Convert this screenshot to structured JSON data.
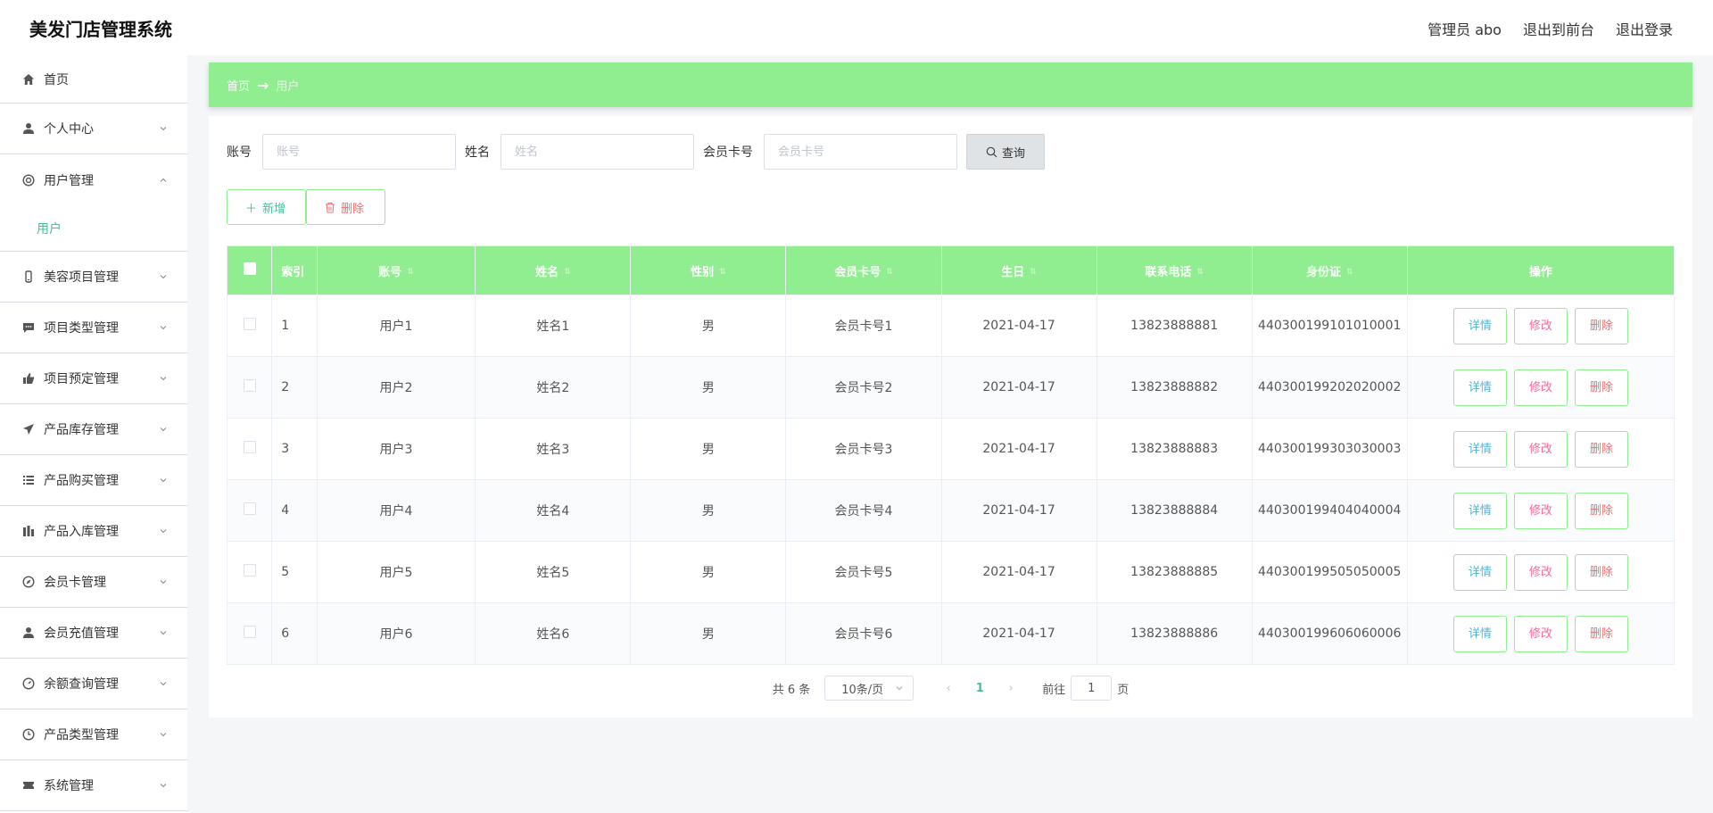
{
  "header": {
    "title": "美发门店管理系统",
    "admin_label": "管理员 abo",
    "back_front_label": "退出到前台",
    "logout_label": "退出登录"
  },
  "sidebar": {
    "items": [
      {
        "label": "首页",
        "icon": "home-icon"
      },
      {
        "label": "个人中心",
        "icon": "user-icon"
      },
      {
        "label": "用户管理",
        "icon": "lifebuoy-icon",
        "open": true,
        "children": [
          {
            "label": "用户"
          }
        ]
      },
      {
        "label": "美容项目管理",
        "icon": "mobile-icon"
      },
      {
        "label": "项目类型管理",
        "icon": "chat-icon"
      },
      {
        "label": "项目预定管理",
        "icon": "thumb-icon"
      },
      {
        "label": "产品库存管理",
        "icon": "send-icon"
      },
      {
        "label": "产品购买管理",
        "icon": "list-icon"
      },
      {
        "label": "产品入库管理",
        "icon": "chart-icon"
      },
      {
        "label": "会员卡管理",
        "icon": "compass-icon"
      },
      {
        "label": "会员充值管理",
        "icon": "user-icon"
      },
      {
        "label": "余额查询管理",
        "icon": "gauge-icon"
      },
      {
        "label": "产品类型管理",
        "icon": "clock-icon"
      },
      {
        "label": "系统管理",
        "icon": "ticket-icon"
      }
    ]
  },
  "breadcrumb": {
    "home": "首页",
    "separator": "→",
    "current": "用户"
  },
  "search": {
    "account_label": "账号",
    "account_placeholder": "账号",
    "name_label": "姓名",
    "name_placeholder": "姓名",
    "card_label": "会员卡号",
    "card_placeholder": "会员卡号",
    "search_button": "查询"
  },
  "actions": {
    "add": "新增",
    "delete": "删除"
  },
  "table": {
    "columns": [
      "索引",
      "账号",
      "姓名",
      "性别",
      "会员卡号",
      "生日",
      "联系电话",
      "身份证",
      "操作"
    ],
    "rows": [
      {
        "index": "1",
        "account": "用户1",
        "name": "姓名1",
        "gender": "男",
        "card": "会员卡号1",
        "birthday": "2021-04-17",
        "phone": "13823888881",
        "idcard": "440300199101010001"
      },
      {
        "index": "2",
        "account": "用户2",
        "name": "姓名2",
        "gender": "男",
        "card": "会员卡号2",
        "birthday": "2021-04-17",
        "phone": "13823888882",
        "idcard": "440300199202020002"
      },
      {
        "index": "3",
        "account": "用户3",
        "name": "姓名3",
        "gender": "男",
        "card": "会员卡号3",
        "birthday": "2021-04-17",
        "phone": "13823888883",
        "idcard": "440300199303030003"
      },
      {
        "index": "4",
        "account": "用户4",
        "name": "姓名4",
        "gender": "男",
        "card": "会员卡号4",
        "birthday": "2021-04-17",
        "phone": "13823888884",
        "idcard": "440300199404040004"
      },
      {
        "index": "5",
        "account": "用户5",
        "name": "姓名5",
        "gender": "男",
        "card": "会员卡号5",
        "birthday": "2021-04-17",
        "phone": "13823888885",
        "idcard": "440300199505050005"
      },
      {
        "index": "6",
        "account": "用户6",
        "name": "姓名6",
        "gender": "男",
        "card": "会员卡号6",
        "birthday": "2021-04-17",
        "phone": "13823888886",
        "idcard": "440300199606060006"
      }
    ],
    "op_detail": "详情",
    "op_edit": "修改",
    "op_delete": "删除"
  },
  "pagination": {
    "total_text": "共 6 条",
    "page_size": "10条/页",
    "current_page": "1",
    "goto_prefix": "前往",
    "goto_value": "1",
    "goto_suffix": "页"
  },
  "colors": {
    "accent": "#90ee90",
    "active_text": "#3cc59b",
    "danger": "#f56c6c"
  }
}
